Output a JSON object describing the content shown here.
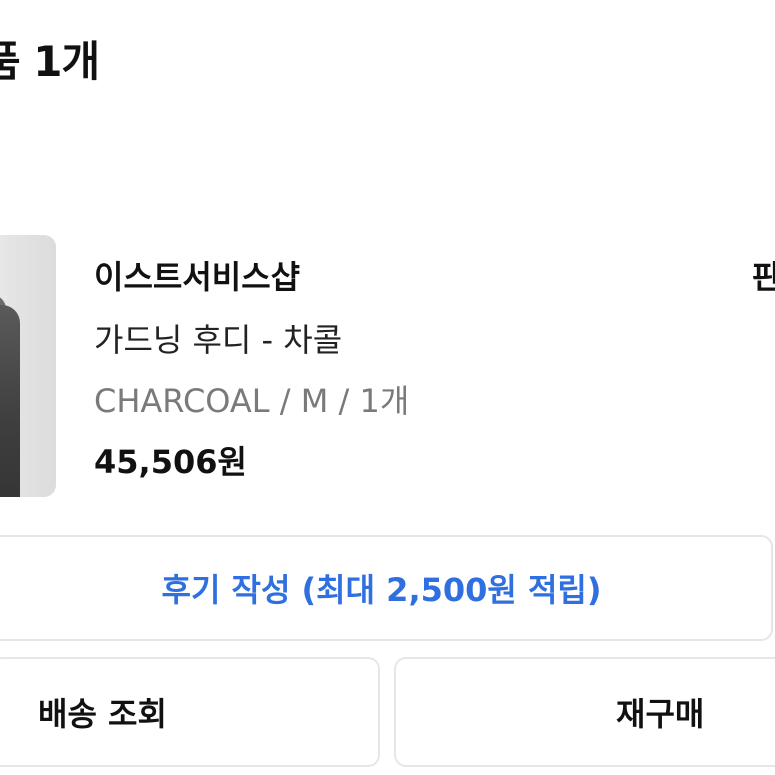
{
  "section": {
    "title": "품 1개"
  },
  "order_item": {
    "shop_name": "이스트서비스샵",
    "edge_label": "판",
    "product_name": "가드닝 후디 - 차콜",
    "option": "CHARCOAL / M / 1개",
    "price": "45,506원",
    "thumbnail_icon": "product-thumbnail"
  },
  "actions": {
    "review_label": "후기 작성  (최대 2,500원 적립)",
    "shipping_label": "배송 조회",
    "rebuy_label": "재구매"
  },
  "colors": {
    "accent": "#2f6fe0",
    "border": "#e6e6e6",
    "muted_text": "#7a7a7a"
  }
}
